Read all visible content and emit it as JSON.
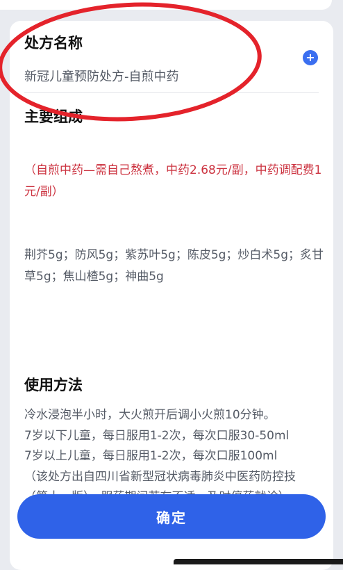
{
  "prescription": {
    "name_heading": "处方名称",
    "name_value": "新冠儿童预防处方-自煎中药",
    "add_symbol": "+"
  },
  "composition": {
    "heading": "主要组成",
    "price_note": "（自煎中药—需自己熬煮，中药2.68元/副，中药调配费1元/副）",
    "ingredients": "荆芥5g；防风5g；紫苏叶5g；陈皮5g；炒白术5g；炙甘草5g；焦山楂5g；神曲5g"
  },
  "usage": {
    "heading": "使用方法",
    "lines": [
      "冷水浸泡半小时，大火煎开后调小火煎10分钟。",
      "7岁以下儿童，每日服用1-2次，每次口服30-50ml",
      "7岁以上儿童，每日服用1-2次，每次口服100ml",
      "（该处方出自四川省新型冠状病毒肺炎中医药防控技",
      "（第十一版），服药期间若有不适，及时停药就诊）"
    ]
  },
  "actions": {
    "confirm_label": "确定"
  },
  "colors": {
    "accent": "#2f62e8",
    "warning_text": "#cc3340",
    "annotation_circle": "#e4232b"
  }
}
